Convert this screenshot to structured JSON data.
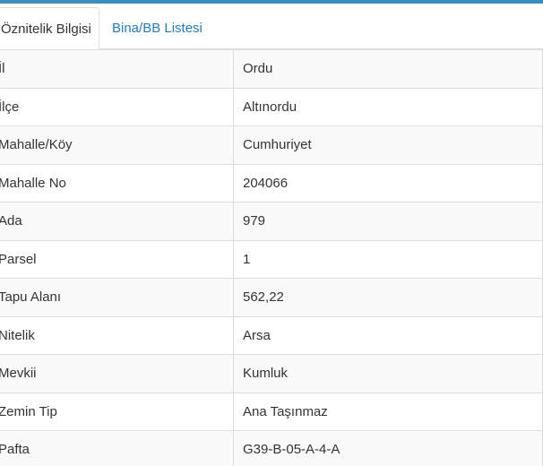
{
  "tabs": {
    "active": "Öznitelik Bilgisi",
    "second": "Bina/BB Listesi"
  },
  "rows": [
    {
      "label": "İl",
      "value": "Ordu"
    },
    {
      "label": "İlçe",
      "value": "Altınordu"
    },
    {
      "label": "Mahalle/Köy",
      "value": "Cumhuriyet"
    },
    {
      "label": "Mahalle No",
      "value": "204066"
    },
    {
      "label": "Ada",
      "value": "979"
    },
    {
      "label": "Parsel",
      "value": "1"
    },
    {
      "label": "Tapu Alanı",
      "value": "562,22"
    },
    {
      "label": "Nitelik",
      "value": "Arsa"
    },
    {
      "label": "Mevkii",
      "value": "Kumluk"
    },
    {
      "label": "Zemin Tip",
      "value": "Ana Taşınmaz"
    },
    {
      "label": "Pafta",
      "value": "G39-B-05-A-4-A"
    }
  ],
  "colors": {
    "accent": "#3c8dbc",
    "link": "#2a7ab8",
    "stripe": "#f9f9f9",
    "border": "#dddddd"
  }
}
